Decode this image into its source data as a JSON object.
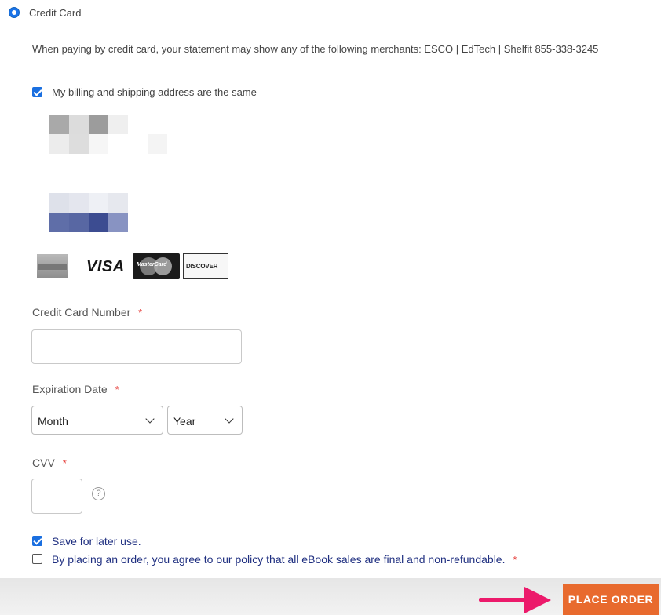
{
  "payment_method": {
    "label": "Credit Card",
    "selected": true
  },
  "merchant_notice": "When paying by credit card, your statement may show any of the following merchants: ESCO | EdTech | Shelfit 855-338-3245",
  "billing_same": {
    "label": "My billing and shipping address are the same",
    "checked": true
  },
  "card_logos": {
    "visa": "VISA",
    "mastercard": "MasterCard",
    "discover": "DISCOVER"
  },
  "card_number": {
    "label": "Credit Card Number",
    "required_mark": "*",
    "value": "",
    "placeholder": ""
  },
  "expiration": {
    "label": "Expiration Date",
    "required_mark": "*",
    "month_value": "Month",
    "year_value": "Year"
  },
  "cvv": {
    "label": "CVV",
    "required_mark": "*",
    "value": "",
    "help_glyph": "?"
  },
  "save_for_later": {
    "label": "Save for later use.",
    "checked": true
  },
  "policy": {
    "label": "By placing an order, you agree to our policy that all eBook sales are final and non-refundable.",
    "required_mark": "*",
    "checked": false
  },
  "place_order": {
    "label": "PLACE ORDER"
  },
  "colors": {
    "accent": "#1a6fe0",
    "button": "#e86a2e",
    "arrow": "#ec1a6b",
    "required": "#e53935",
    "policy_text": "#1f2f80"
  }
}
